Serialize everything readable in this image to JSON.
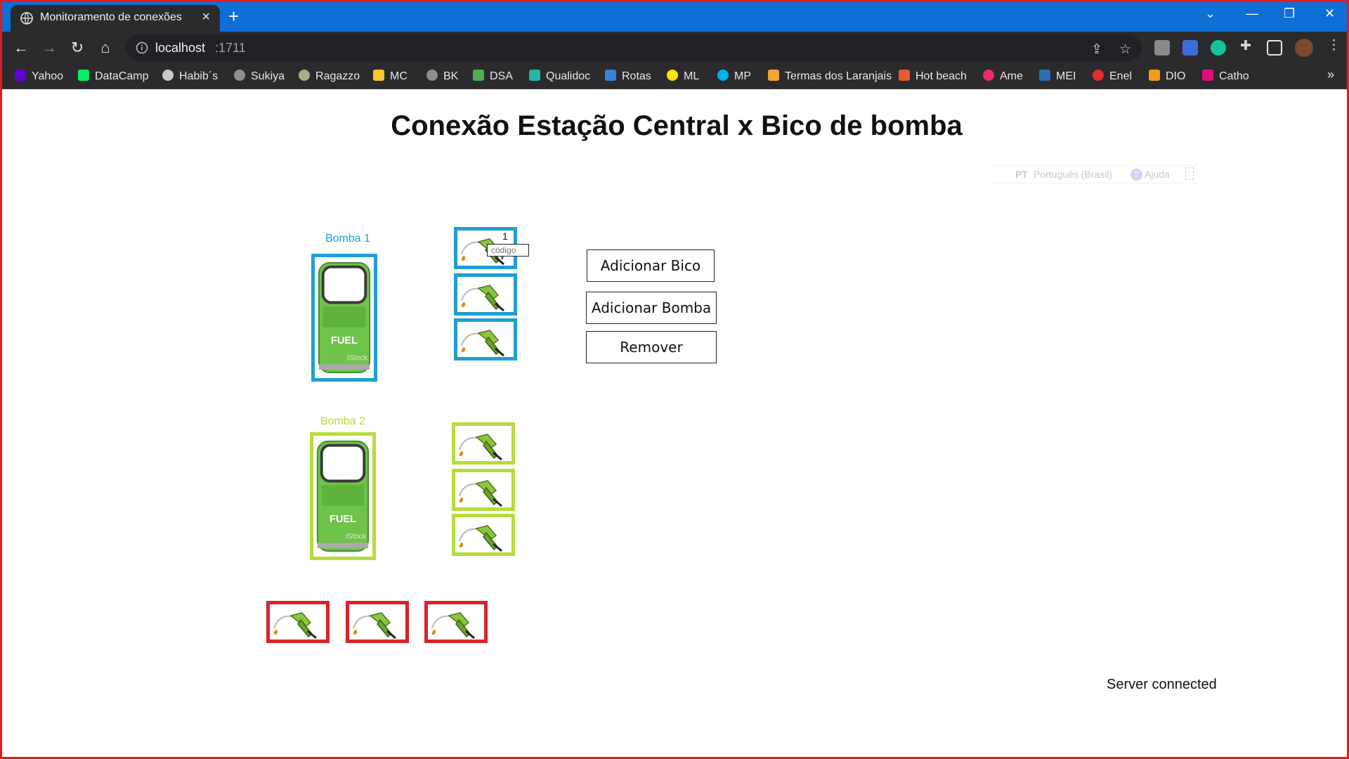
{
  "browser": {
    "tab_title": "Monitoramento de conexões",
    "url_host": "localhost",
    "url_port": ":1711",
    "bookmarks": [
      "Yahoo",
      "DataCamp",
      "Habib´s",
      "Sukiya",
      "Ragazzo",
      "MC",
      "BK",
      "DSA",
      "Qualidoc",
      "Rotas",
      "ML",
      "MP",
      "Termas dos Laranjais",
      "Hot beach",
      "Ame",
      "MEI",
      "Enel",
      "DIO",
      "Catho"
    ]
  },
  "page": {
    "title": "Conexão Estação Central x Bico de bomba",
    "language_code": "PT",
    "language_name": "Português (Brasil)",
    "help_label": "Ajuda",
    "pumps": [
      {
        "label": "Bomba 1",
        "color": "#1e9fd4",
        "pump_text": "FUEL",
        "watermark": "iStock"
      },
      {
        "label": "Bomba 2",
        "color": "#b6dc3c",
        "pump_text": "FUEL",
        "watermark": "iStock"
      }
    ],
    "unassigned_color": "#d8232a",
    "nozzle_code_number": "1",
    "nozzle_code_placeholder": "código",
    "buttons": {
      "add_nozzle": "Adicionar Bico",
      "add_pump": "Adicionar Bomba",
      "remove": "Remover"
    },
    "status": "Server connected"
  }
}
